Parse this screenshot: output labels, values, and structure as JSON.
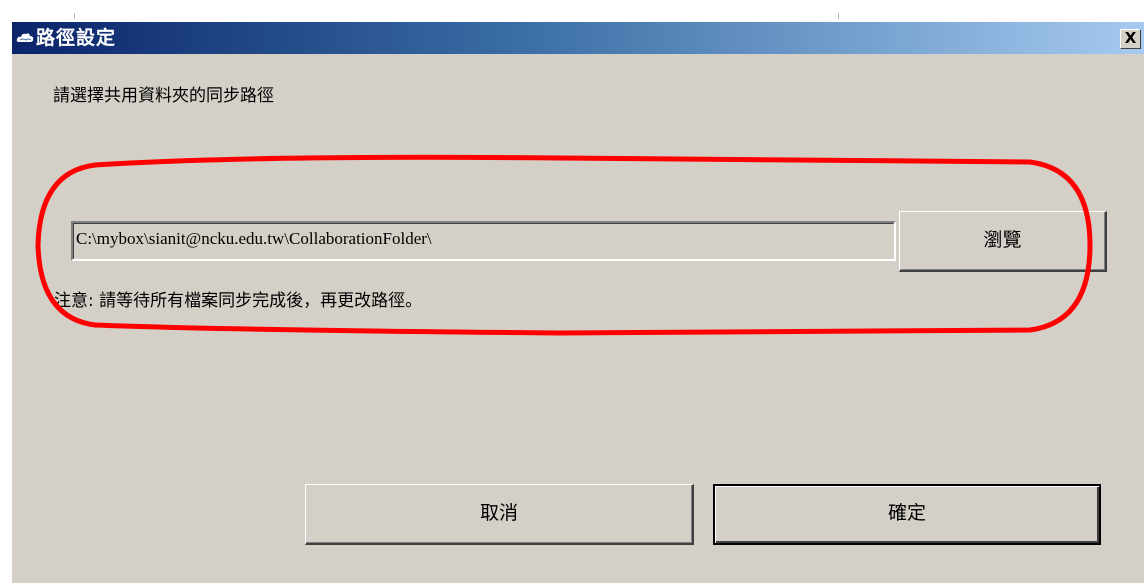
{
  "dialog": {
    "title": "路徑設定",
    "close_label": "X"
  },
  "content": {
    "instruction": "請選擇共用資料夾的同步路徑",
    "path_value": "C:\\mybox\\sianit@ncku.edu.tw\\CollaborationFolder\\",
    "browse_label": "瀏覽",
    "note": "注意: 請等待所有檔案同步完成後，再更改路徑。"
  },
  "footer": {
    "cancel_label": "取消",
    "ok_label": "確定"
  },
  "annotation": {
    "color": "#ff0000"
  },
  "icons": [
    "cloud-icon",
    "close-icon"
  ]
}
